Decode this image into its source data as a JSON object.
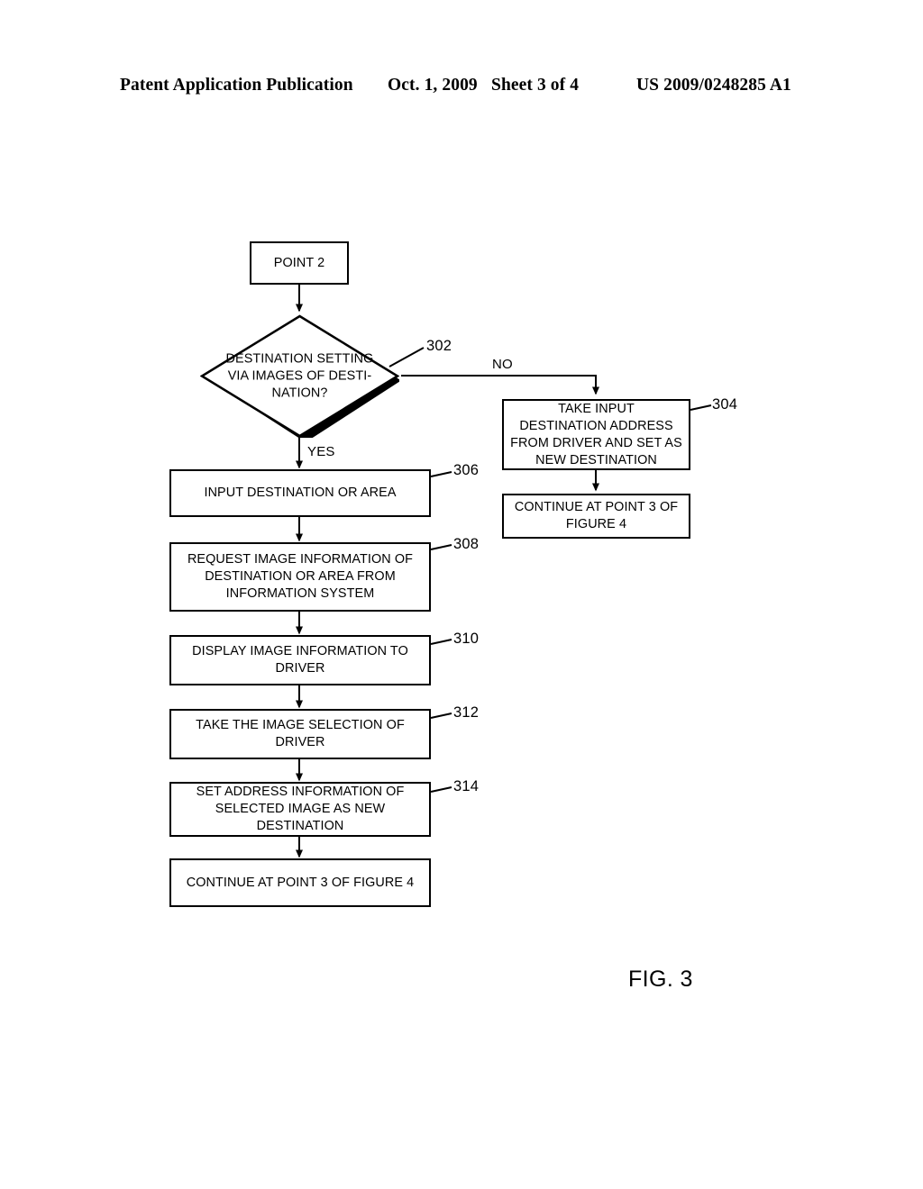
{
  "header": {
    "publication": "Patent Application Publication",
    "date": "Oct. 1, 2009",
    "sheet": "Sheet 3 of 4",
    "patent_number": "US 2009/0248285 A1"
  },
  "figure": {
    "caption": "FIG. 3",
    "nodes": {
      "point2": {
        "label": "POINT 2",
        "ref": ""
      },
      "decision302": {
        "label": "DESTINATION SETTING\nVIA IMAGES OF  DESTI-\nNATION?",
        "ref": "302"
      },
      "box304": {
        "label": "TAKE INPUT\nDESTINATION ADDRESS\nFROM DRIVER AND SET AS\nNEW DESTINATION",
        "ref": "304"
      },
      "box304b": {
        "label": "CONTINUE AT POINT 3 OF\nFIGURE 4",
        "ref": ""
      },
      "box306": {
        "label": "INPUT DESTINATION OR AREA",
        "ref": "306"
      },
      "box308": {
        "label": "REQUEST IMAGE INFORMATION OF\nDESTINATION OR AREA FROM\nINFORMATION SYSTEM",
        "ref": "308"
      },
      "box310": {
        "label": "DISPLAY IMAGE INFORMATION TO\nDRIVER",
        "ref": "310"
      },
      "box312": {
        "label": "TAKE THE IMAGE SELECTION OF\nDRIVER",
        "ref": "312"
      },
      "box314": {
        "label": "SET ADDRESS INFORMATION OF\nSELECTED IMAGE AS NEW\nDESTINATION",
        "ref": "314"
      },
      "box316": {
        "label": "CONTINUE AT POINT 3 OF FIGURE 4",
        "ref": ""
      }
    },
    "branches": {
      "yes": "YES",
      "no": "NO"
    },
    "colors": {
      "stroke": "#000000",
      "fill": "#ffffff",
      "shadow": "#000000"
    }
  }
}
